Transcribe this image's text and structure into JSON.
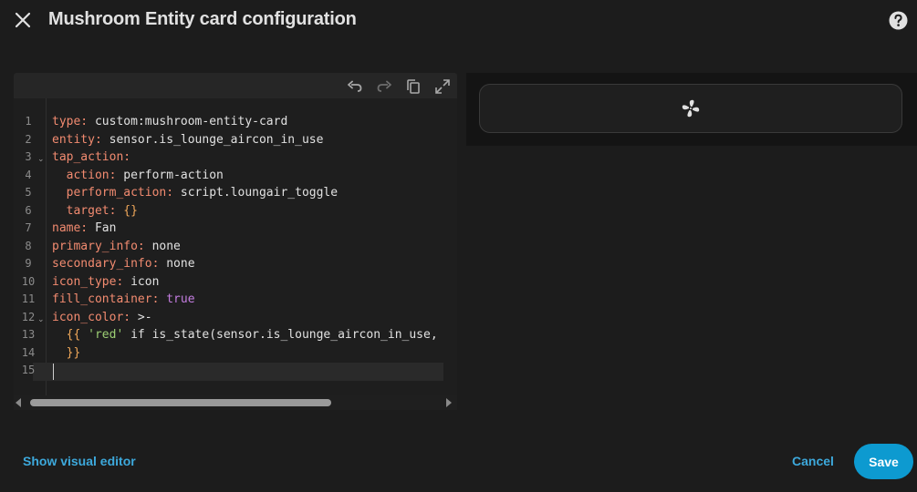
{
  "dialog": {
    "title": "Mushroom Entity card configuration",
    "close_icon": "close-icon",
    "help_icon": "help-circle-icon"
  },
  "editor": {
    "toolbar": [
      "undo-icon",
      "redo-icon",
      "copy-icon",
      "fullscreen-icon"
    ],
    "line_numbers": [
      "1",
      "2",
      "3",
      "4",
      "5",
      "6",
      "7",
      "8",
      "9",
      "10",
      "11",
      "12",
      "13",
      "14",
      "15"
    ],
    "fold_lines": [
      3,
      12
    ],
    "lines": [
      [
        {
          "t": "type:",
          "c": "k"
        },
        {
          "t": " custom:mushroom-entity-card",
          "c": "v"
        }
      ],
      [
        {
          "t": "entity:",
          "c": "k"
        },
        {
          "t": " sensor.is_lounge_aircon_in_use",
          "c": "v"
        }
      ],
      [
        {
          "t": "tap_action:",
          "c": "k"
        }
      ],
      [
        {
          "t": "  action:",
          "c": "k"
        },
        {
          "t": " perform-action",
          "c": "v"
        }
      ],
      [
        {
          "t": "  perform_action:",
          "c": "k"
        },
        {
          "t": " script.loungair_toggle",
          "c": "v"
        }
      ],
      [
        {
          "t": "  target:",
          "c": "k"
        },
        {
          "t": " {}",
          "c": "b"
        }
      ],
      [
        {
          "t": "name:",
          "c": "k"
        },
        {
          "t": " Fan",
          "c": "v"
        }
      ],
      [
        {
          "t": "primary_info:",
          "c": "k"
        },
        {
          "t": " none",
          "c": "v"
        }
      ],
      [
        {
          "t": "secondary_info:",
          "c": "k"
        },
        {
          "t": " none",
          "c": "v"
        }
      ],
      [
        {
          "t": "icon_type:",
          "c": "k"
        },
        {
          "t": " icon",
          "c": "v"
        }
      ],
      [
        {
          "t": "fill_container:",
          "c": "k"
        },
        {
          "t": " true",
          "c": "p"
        }
      ],
      [
        {
          "t": "icon_color:",
          "c": "k"
        },
        {
          "t": " >-",
          "c": "v"
        }
      ],
      [
        {
          "t": "  {{ ",
          "c": "b"
        },
        {
          "t": "'red'",
          "c": "s"
        },
        {
          "t": " if is_state(sensor.is_lounge_aircon_in_use,",
          "c": "v"
        }
      ],
      [
        {
          "t": "  }}",
          "c": "b"
        }
      ],
      []
    ]
  },
  "preview": {
    "icon": "fan-icon"
  },
  "footer": {
    "visual_editor_label": "Show visual editor",
    "cancel_label": "Cancel",
    "save_label": "Save"
  },
  "colors": {
    "accent": "#3da9dc",
    "save_bg": "#0d9ad0",
    "yaml_key": "#f28b70",
    "yaml_bool": "#c47de0",
    "yaml_string": "#9ccf74",
    "yaml_bracket": "#f0a85a"
  }
}
